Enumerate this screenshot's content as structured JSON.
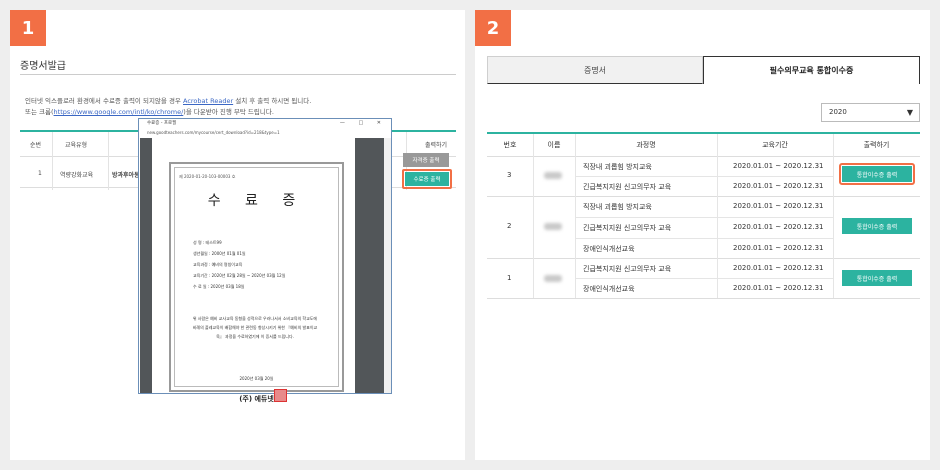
{
  "step1": {
    "badge": "1",
    "section_title": "증명서발급",
    "notice_line1_pre": "인터넷 익스플로러 환경에서 수료증 출력이 되지않을 경우",
    "notice_link1": "Acrobat Reader",
    "notice_line1_post": "설치 후 출력 하시면 됩니다.",
    "notice_line2_pre": "또는 크롬(",
    "notice_link2": "https://www.google.com/intl/ko/chrome/",
    "notice_line2_post": ")을 다운받아 진행 부탁 드립니다.",
    "table": {
      "headers": [
        "순번",
        "교육유형",
        "출력하기"
      ],
      "row": {
        "no": "1",
        "type": "역량강화교육",
        "course": "방과후아동지"
      },
      "btn_qual": "자격증 출력",
      "btn_cert": "수료증 출력"
    },
    "popup": {
      "title": "수료증 - 프로필",
      "controls": "— □ ✕",
      "url": "new.goodteachers.com/mycourse/cert_download?id=218&type=1",
      "cert_no": "제 2020-01-20-103-00003 호",
      "cert_title": "수 료 증",
      "fields": [
        "성  명 : 테스트99",
        "생년월일 : 2000년 01월 01일",
        "교육과정 : 예비의 명칭이교육",
        "교육기간 : 2020년 02월 28일 ~ 2020년 03월 12일",
        "수 료 일 : 2020년 03월 18일"
      ],
      "body": "위 사람은 예비 교사교육 동형을 성적으로 우러나서서 소비교육의 학교도에 비례의 플레교육이 배합해야 한 관련동 향상시키기 위한 『예비의 발표이교육』 과정을 수료하였기에 이 증서를 드립니다.",
      "date": "2020년 03월 20일",
      "org": "(주) 에듀넷"
    }
  },
  "step2": {
    "badge": "2",
    "tab_cert": "증명서",
    "tab_required": "필수의무교육 통합이수증",
    "year": "2020",
    "year_arrow": "▼",
    "headers": [
      "번호",
      "이름",
      "과정명",
      "교육기간",
      "출력하기"
    ],
    "groups": [
      {
        "no": "3",
        "btn": "통합이수증 출력",
        "courses": [
          {
            "name": "직장내 괴롭힘 방지교육",
            "period": "2020.01.01 ~ 2020.12.31"
          },
          {
            "name": "긴급복지지원 신고의무자 교육",
            "period": "2020.01.01 ~ 2020.12.31"
          }
        ]
      },
      {
        "no": "2",
        "btn": "통합이수증 출력",
        "courses": [
          {
            "name": "직장내 괴롭힘 방지교육",
            "period": "2020.01.01 ~ 2020.12.31"
          },
          {
            "name": "긴급복지지원 신고의무자 교육",
            "period": "2020.01.01 ~ 2020.12.31"
          },
          {
            "name": "장애인식개선교육",
            "period": "2020.01.01 ~ 2020.12.31"
          }
        ]
      },
      {
        "no": "1",
        "btn": "통합이수증 출력",
        "courses": [
          {
            "name": "긴급복지지원 신고의무자 교육",
            "period": "2020.01.01 ~ 2020.12.31"
          },
          {
            "name": "장애인식개선교육",
            "period": "2020.01.01 ~ 2020.12.31"
          }
        ]
      }
    ]
  },
  "colors": {
    "accent": "#2cb3a0",
    "highlight": "#f26f45",
    "badge": "#f26f45"
  }
}
